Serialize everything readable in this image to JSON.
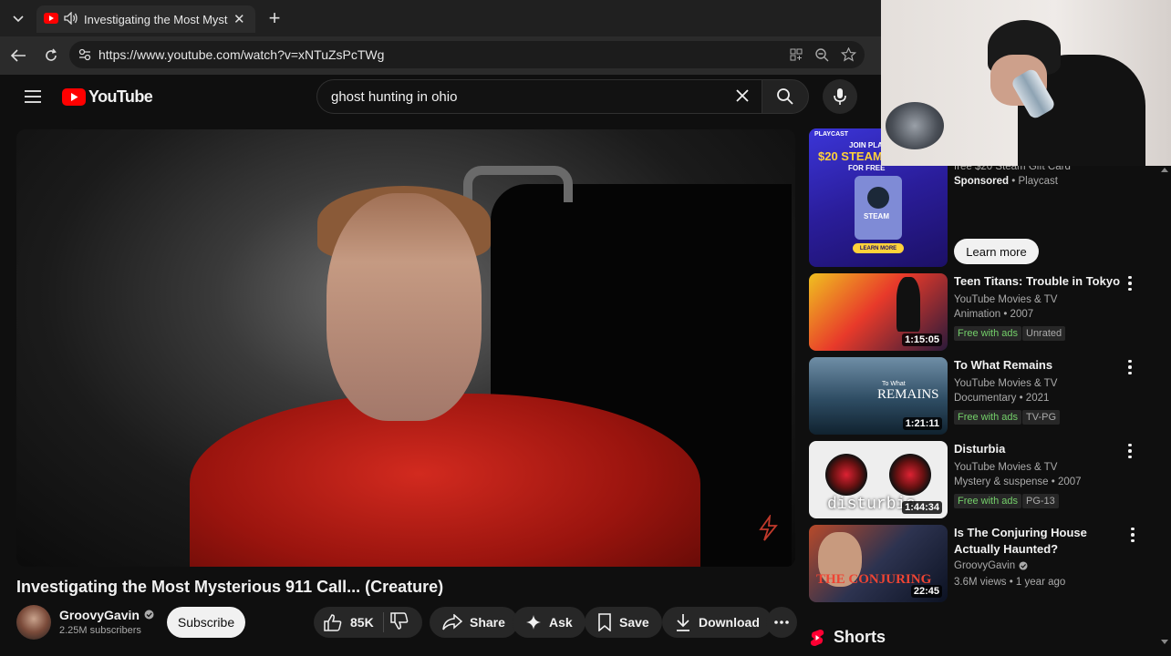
{
  "browser": {
    "tab_title": "Investigating the Most Myster",
    "url": "https://www.youtube.com/watch?v=xNTuZsPcTWg"
  },
  "youtube": {
    "logo_text": "YouTube",
    "search_query": "ghost hunting in ohio"
  },
  "video": {
    "title": "Investigating the Most Mysterious 911 Call... (Creature)",
    "channel": "GroovyGavin",
    "subscribers": "2.25M subscribers",
    "subscribe_label": "Subscribe",
    "likes": "85K",
    "share_label": "Share",
    "ask_label": "Ask",
    "save_label": "Save",
    "download_label": "Download"
  },
  "ad": {
    "brand_top": "PLAYCAST",
    "headline_small": "JOIN PLAYCAST",
    "offer": "$20 STEAM",
    "free": "FOR FREE",
    "steam": "STEAM",
    "learn_more_small": "LEARN MORE",
    "desc": "free $20 Steam Gift Card",
    "sponsored": "Sponsored",
    "advertiser": "Playcast",
    "learn_more": "Learn more"
  },
  "recommendations": [
    {
      "title": "Teen Titans: Trouble in Tokyo",
      "channel": "YouTube Movies & TV",
      "meta": "Animation • 2007",
      "badge1": "Free with ads",
      "badge2": "Unrated",
      "duration": "1:15:05"
    },
    {
      "title": "To What Remains",
      "channel": "YouTube Movies & TV",
      "meta": "Documentary • 2021",
      "badge1": "Free with ads",
      "badge2": "TV-PG",
      "duration": "1:21:11",
      "thumb_text": "REMAINS",
      "thumb_small": "To What"
    },
    {
      "title": "Disturbia",
      "channel": "YouTube Movies & TV",
      "meta": "Mystery & suspense • 2007",
      "badge1": "Free with ads",
      "badge2": "PG-13",
      "duration": "1:44:34",
      "thumb_text": "disturbia"
    },
    {
      "title": "Is The Conjuring House Actually Haunted?",
      "channel": "GroovyGavin",
      "meta": "3.6M views • 1 year ago",
      "duration": "22:45",
      "thumb_text": "THE CONJURING"
    }
  ],
  "shorts_label": "Shorts"
}
